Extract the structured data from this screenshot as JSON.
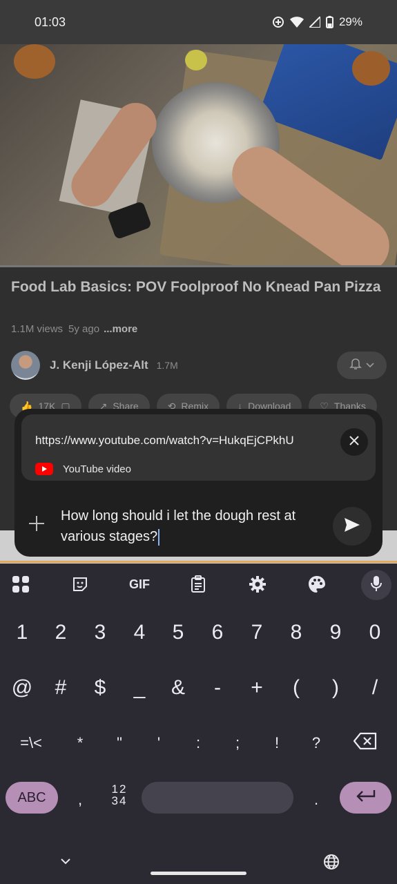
{
  "status_bar": {
    "time": "01:03",
    "battery": "29%"
  },
  "video": {
    "title": "Food Lab Basics: POV Foolproof No Knead Pan Pizza",
    "views": "1.1M views",
    "ago": "5y ago",
    "more": "...more",
    "channel_name": "J. Kenji López-Alt",
    "subscribers": "1.7M",
    "chips": [
      "17K",
      "",
      "Share",
      "Remix",
      "Download",
      "Thanks"
    ]
  },
  "prompt": {
    "attachment_url": "https://www.youtube.com/watch?v=HukqEjCPkhU",
    "attachment_source": "YouTube video",
    "query_text": "How long should i let the dough rest at various stages?"
  },
  "keyboard": {
    "toolbar": {
      "gif_label": "GIF"
    },
    "row_numbers": [
      "1",
      "2",
      "3",
      "4",
      "5",
      "6",
      "7",
      "8",
      "9",
      "0"
    ],
    "row_symbols1": [
      "@",
      "#",
      "$",
      "_",
      "&",
      "-",
      "+",
      "(",
      ")",
      "/"
    ],
    "row_symbols2": [
      "=\\<",
      "*",
      "\"",
      "'",
      ":",
      ";",
      "!",
      "?"
    ],
    "abc_label": "ABC",
    "comma": ",",
    "numsym_label_top": "12",
    "numsym_label_bottom": "34",
    "period": "."
  },
  "colors": {
    "accent_key": "#b58fb6",
    "youtube_red": "#ff0000",
    "caret": "#8ab4f8"
  }
}
